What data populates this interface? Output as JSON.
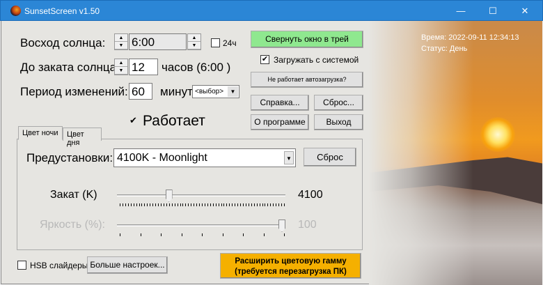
{
  "window": {
    "title": "SunsetScreen v1.50",
    "minimize": "—",
    "maximize": "☐",
    "close": "✕"
  },
  "sunrise": {
    "label": "Восход солнца:",
    "value": "6:00",
    "h24_label": "24ч",
    "h24_checked": false
  },
  "until_sunset": {
    "label": "До заката солнца:",
    "value": "12",
    "unit": "часов  (6:00 )"
  },
  "period": {
    "label": "Период изменений:",
    "value": "60",
    "unit": "минут",
    "select": "<выбор>"
  },
  "working": {
    "label": "Работает",
    "checked": true
  },
  "tabs": [
    {
      "label": "Цвет ночи",
      "active": true
    },
    {
      "label": "Цвет дня",
      "active": false
    }
  ],
  "presets": {
    "label": "Предустановки:",
    "value": "4100K - Moonlight",
    "reset": "Сброс"
  },
  "sunset_slider": {
    "label": "Закат (K)",
    "value": "4100",
    "fraction": 0.3
  },
  "brightness_slider": {
    "label": "Яркость (%):",
    "value": "100",
    "fraction": 1.0
  },
  "hsb": {
    "label": "HSB слайдеры",
    "checked": false
  },
  "more_settings": "Больше настроек...",
  "extend_gamma": [
    "Расширить цветовую гамму",
    "(требуется перезагрузка ПК)"
  ],
  "right": {
    "tray": "Свернуть окно в трей",
    "autostart_label": "Загружать с системой",
    "autostart_checked": true,
    "autostart_help": "Не работает автозагрузка?",
    "help": "Справка...",
    "reset": "Сброс...",
    "about": "О программе",
    "exit": "Выход"
  },
  "status": {
    "time": "Время: 2022-09-11 12:34:13",
    "state": "Статус: День"
  },
  "colors": {
    "tray_button": "#8fe88f",
    "gamma_button": "#f5b000",
    "titlebar": "#2b86d6"
  }
}
